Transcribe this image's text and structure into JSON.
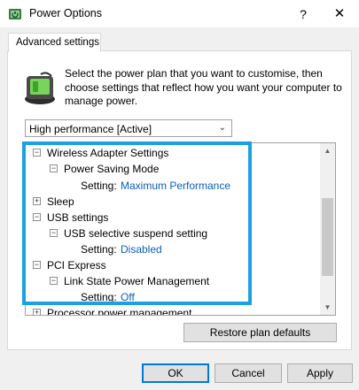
{
  "window": {
    "title": "Power Options",
    "help_glyph": "?",
    "close_glyph": "✕"
  },
  "tab": {
    "label": "Advanced settings"
  },
  "description": "Select the power plan that you want to customise, then choose settings that reflect how you want your computer to manage power.",
  "plan_select": {
    "value": "High performance [Active]",
    "arrow": "⌄"
  },
  "tree": {
    "partial_top": "",
    "wireless": {
      "label": "Wireless Adapter Settings",
      "toggle": "−",
      "child": {
        "label": "Power Saving Mode",
        "toggle": "−",
        "setting_label": "Setting:",
        "setting_value": "Maximum Performance"
      }
    },
    "sleep": {
      "label": "Sleep",
      "toggle": "+"
    },
    "usb": {
      "label": "USB settings",
      "toggle": "−",
      "child": {
        "label": "USB selective suspend setting",
        "toggle": "−",
        "setting_label": "Setting:",
        "setting_value": "Disabled"
      }
    },
    "pci": {
      "label": "PCI Express",
      "toggle": "−",
      "child": {
        "label": "Link State Power Management",
        "toggle": "−",
        "setting_label": "Setting:",
        "setting_value": "Off"
      }
    },
    "processor": {
      "label": "Processor power management",
      "toggle": "+"
    }
  },
  "scrollbar": {
    "up_glyph": "▲",
    "down_glyph": "▼"
  },
  "buttons": {
    "restore": "Restore plan defaults",
    "ok": "OK",
    "cancel": "Cancel",
    "apply": "Apply"
  },
  "colors": {
    "highlight": "#1aa0e3",
    "setting_value": "#0b5fb8",
    "ok_border": "#0078d7"
  }
}
